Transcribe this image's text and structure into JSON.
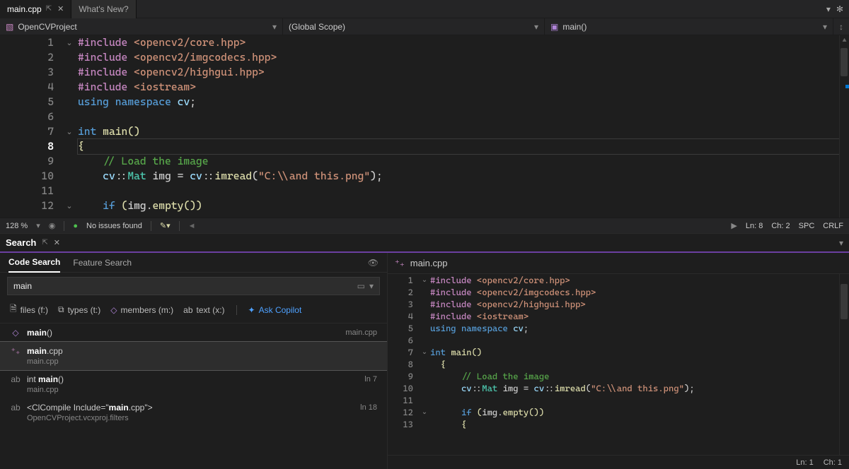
{
  "tabs": {
    "active": "main.cpp",
    "pinned": true,
    "second": "What's New?"
  },
  "nav": {
    "project_icon_color": "#c586c0",
    "project": "OpenCVProject",
    "scope": "(Global Scope)",
    "func_icon_color": "#b084d8",
    "func": "main()"
  },
  "editor": {
    "lines": [
      {
        "n": 1,
        "fold": "v"
      },
      {
        "n": 2
      },
      {
        "n": 3
      },
      {
        "n": 4
      },
      {
        "n": 5
      },
      {
        "n": 6
      },
      {
        "n": 7,
        "fold": "v"
      },
      {
        "n": 8,
        "cur": true
      },
      {
        "n": 9
      },
      {
        "n": 10
      },
      {
        "n": 11
      },
      {
        "n": 12,
        "fold": "v"
      }
    ],
    "code": {
      "include1a": "#include ",
      "include1b": "<opencv2/core.hpp>",
      "include2a": "#include ",
      "include2b": "<opencv2/imgcodecs.hpp>",
      "include3a": "#include ",
      "include3b": "<opencv2/highgui.hpp>",
      "include4a": "#include ",
      "include4b": "<iostream>",
      "using": "using",
      "namespace": "namespace",
      "cv": "cv",
      "semi": ";",
      "int": "int",
      "main": "main",
      "parens": "()",
      "lbrace": "{",
      "comment": "// Load the image",
      "cvns": "cv",
      "dbl": "::",
      "mat": "Mat",
      "img": "img",
      "eq": "=",
      "imread": "imread",
      "lp": "(",
      "str": "\"C:\\\\and this.png\"",
      "rp": ")",
      "if": "if",
      "empty": "empty",
      "dot": ".",
      "pp": "()"
    }
  },
  "status": {
    "zoom": "128 %",
    "issues": "No issues found",
    "ln": "Ln: 8",
    "ch": "Ch: 2",
    "enc": "SPC",
    "eol": "CRLF"
  },
  "search": {
    "title": "Search",
    "tabs": {
      "code": "Code Search",
      "feature": "Feature Search"
    },
    "query": "main",
    "filters": {
      "files": "files (f:)",
      "types": "types (t:)",
      "members": "members (m:)",
      "text": "text (x:)",
      "copilot": "Ask Copilot"
    },
    "results": [
      {
        "icon": "fn",
        "label": "main",
        "suffix": "()",
        "right": "main.cpp"
      },
      {
        "icon": "file",
        "label_pre": "",
        "label_bold": "main",
        "label_post": ".cpp",
        "sub": "main.cpp",
        "sel": true
      },
      {
        "icon": "ab",
        "label_pre": "int ",
        "label_bold": "main",
        "label_post": "()",
        "sub": "main.cpp",
        "right": "ln 7"
      },
      {
        "icon": "ab",
        "label_pre": "<ClCompile Include=\"",
        "label_bold": "main",
        "label_post": ".cpp\">",
        "sub": "OpenCVProject.vcxproj.filters",
        "right": "ln 18"
      }
    ]
  },
  "preview": {
    "file": "main.cpp",
    "status": {
      "ln": "Ln: 1",
      "ch": "Ch: 1"
    },
    "lines": [
      1,
      2,
      3,
      4,
      5,
      6,
      7,
      8,
      9,
      10,
      11,
      12,
      13
    ]
  }
}
